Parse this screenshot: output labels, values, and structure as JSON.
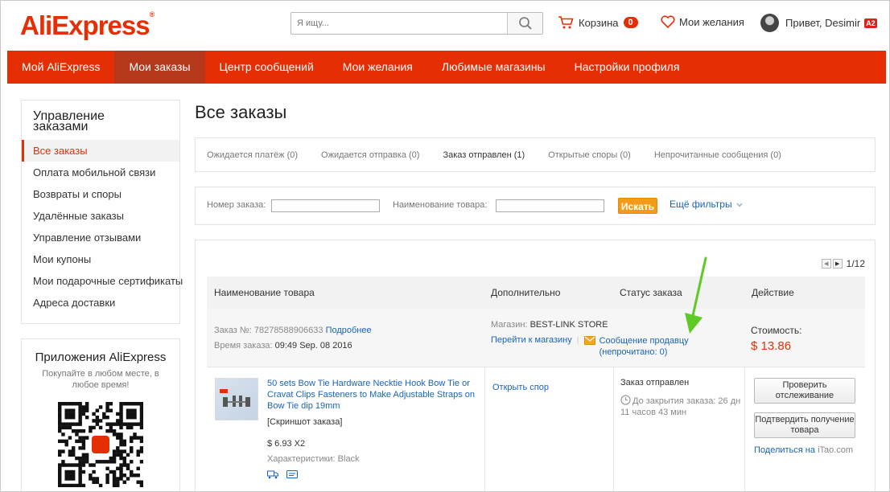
{
  "colors": {
    "brand": "#e62e04",
    "nav_active": "#b5381b",
    "link": "#1a64b5",
    "search_button": "#f39b18",
    "annotation_arrow": "#5fc926"
  },
  "header": {
    "logo": "AliExpress",
    "logo_mark": "®",
    "search_placeholder": "Я ищу...",
    "search_icon": "magnifier-icon",
    "cart_label": "Корзина",
    "cart_count": "0",
    "wishlist_label": "Мои желания",
    "greeting": "Привет, Desimir",
    "level_badge": "A2"
  },
  "nav": {
    "items": [
      {
        "label": "Мой AliExpress"
      },
      {
        "label": "Мои заказы"
      },
      {
        "label": "Центр сообщений"
      },
      {
        "label": "Мои желания"
      },
      {
        "label": "Любимые магазины"
      },
      {
        "label": "Настройки профиля"
      }
    ],
    "active_index": 1
  },
  "sidebar": {
    "title": "Управление заказами",
    "items": [
      {
        "label": "Все заказы"
      },
      {
        "label": "Оплата мобильной связи"
      },
      {
        "label": "Возвраты и споры"
      },
      {
        "label": "Удалённые заказы"
      },
      {
        "label": "Управление отзывами"
      },
      {
        "label": "Мои купоны"
      },
      {
        "label": "Мои подарочные сертификаты"
      },
      {
        "label": "Адреса доставки"
      }
    ]
  },
  "apps": {
    "title": "Приложения AliExpress",
    "subtitle": "Покупайте в любом месте, в любое время!"
  },
  "main": {
    "title": "Все заказы",
    "tabs": [
      {
        "label": "Ожидается платёж (0)"
      },
      {
        "label": "Ожидается отправка (0)"
      },
      {
        "label": "Заказ отправлен (1)"
      },
      {
        "label": "Открытые споры (0)"
      },
      {
        "label": "Непрочитанные сообщения (0)"
      }
    ],
    "filters": {
      "order_number_label": "Номер заказа:",
      "product_name_label": "Наименование товара:",
      "search_button": "Искать",
      "more_filters": "Ещё фильтры"
    },
    "pager": {
      "page": "1/12"
    },
    "table_headers": [
      "Наименование товара",
      "Дополнительно",
      "Статус заказа",
      "Действие"
    ],
    "order": {
      "order_number_label": "Заказ №:",
      "order_number": "78278588906633",
      "details_link": "Подробнее",
      "order_time_label": "Время заказа:",
      "order_time": "09:49 Sep. 08 2016",
      "store_label": "Магазин:",
      "store_name": "BEST-LINK STORE",
      "go_to_store": "Перейти к магазину",
      "message_seller": "Сообщение продавцу",
      "unread": "(непрочитано: 0)",
      "cost_label": "Стоимость:",
      "cost": "$ 13.86",
      "product_name": "50 sets Bow Tie Hardware Necktie Hook Bow Tie or Cravat Clips Fasteners to Make Adjustable Straps on Bow Tie dip 19mm",
      "snapshot": "[Скриншот заказа]",
      "unit_price": "$ 6.93 X2",
      "properties": "Характеристики: Black",
      "open_dispute": "Открыть спор",
      "status": "Заказ отправлен",
      "countdown": "До закрытия заказа: 26 дн 11 часов 43 мин",
      "track_button": "Проверить отслеживание",
      "confirm_button": "Подтвердить получение товара",
      "share_prefix": "Поделиться на",
      "share_target": "iTao.com"
    }
  }
}
